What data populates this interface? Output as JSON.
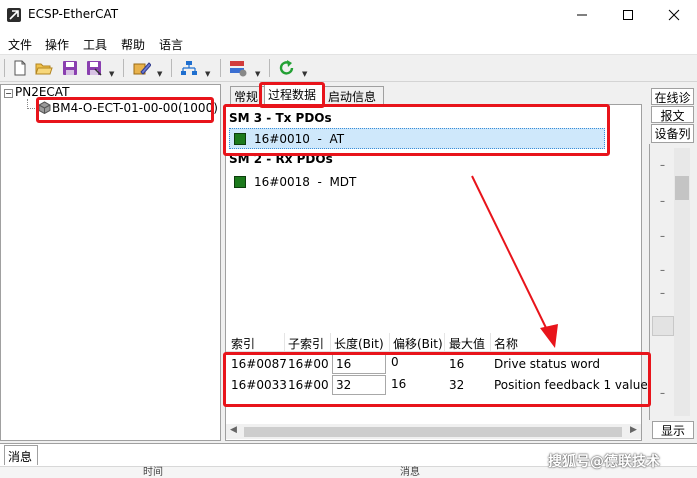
{
  "window": {
    "title": "ECSP-EtherCAT"
  },
  "menu": [
    "文件",
    "操作",
    "工具",
    "帮助",
    "语言"
  ],
  "toolbar_icons": [
    "new-file-icon",
    "open-folder-icon",
    "save-icon",
    "save-as-icon",
    "edit-icon",
    "network-scan-icon",
    "config-icon",
    "refresh-icon"
  ],
  "tree": {
    "root": "PN2ECAT",
    "device": "BM4-O-ECT-01-00-00(1000)"
  },
  "tabs": [
    "常规",
    "过程数据",
    "启动信息"
  ],
  "pdo": {
    "sm3_title": "SM 3 - Tx PDOs",
    "sm3_item": "16#0010  -  AT",
    "sm2_title": "SM 2 - Rx PDOs",
    "sm2_item": "16#0018  -  MDT"
  },
  "table": {
    "headers": [
      "索引",
      "子索引",
      "长度(Bit)",
      "偏移(Bit)",
      "最大值",
      "名称"
    ],
    "rows": [
      [
        "16#0087",
        "16#00",
        "16",
        "0",
        "16",
        "Drive status word"
      ],
      [
        "16#0033",
        "16#00",
        "32",
        "16",
        "32",
        "Position feedback 1 value"
      ]
    ]
  },
  "right_panel": {
    "tabs": [
      "在线诊",
      "报文",
      "设备列"
    ],
    "bottom_button": "显示"
  },
  "messages": {
    "tab": "消息",
    "col1": "时间",
    "col2": "消息"
  },
  "watermark": "搜狐号@德联技术",
  "colors": {
    "highlight": "#e8141b",
    "pdo_square": "#1c7a1c",
    "selection": "#cfe8fb"
  }
}
